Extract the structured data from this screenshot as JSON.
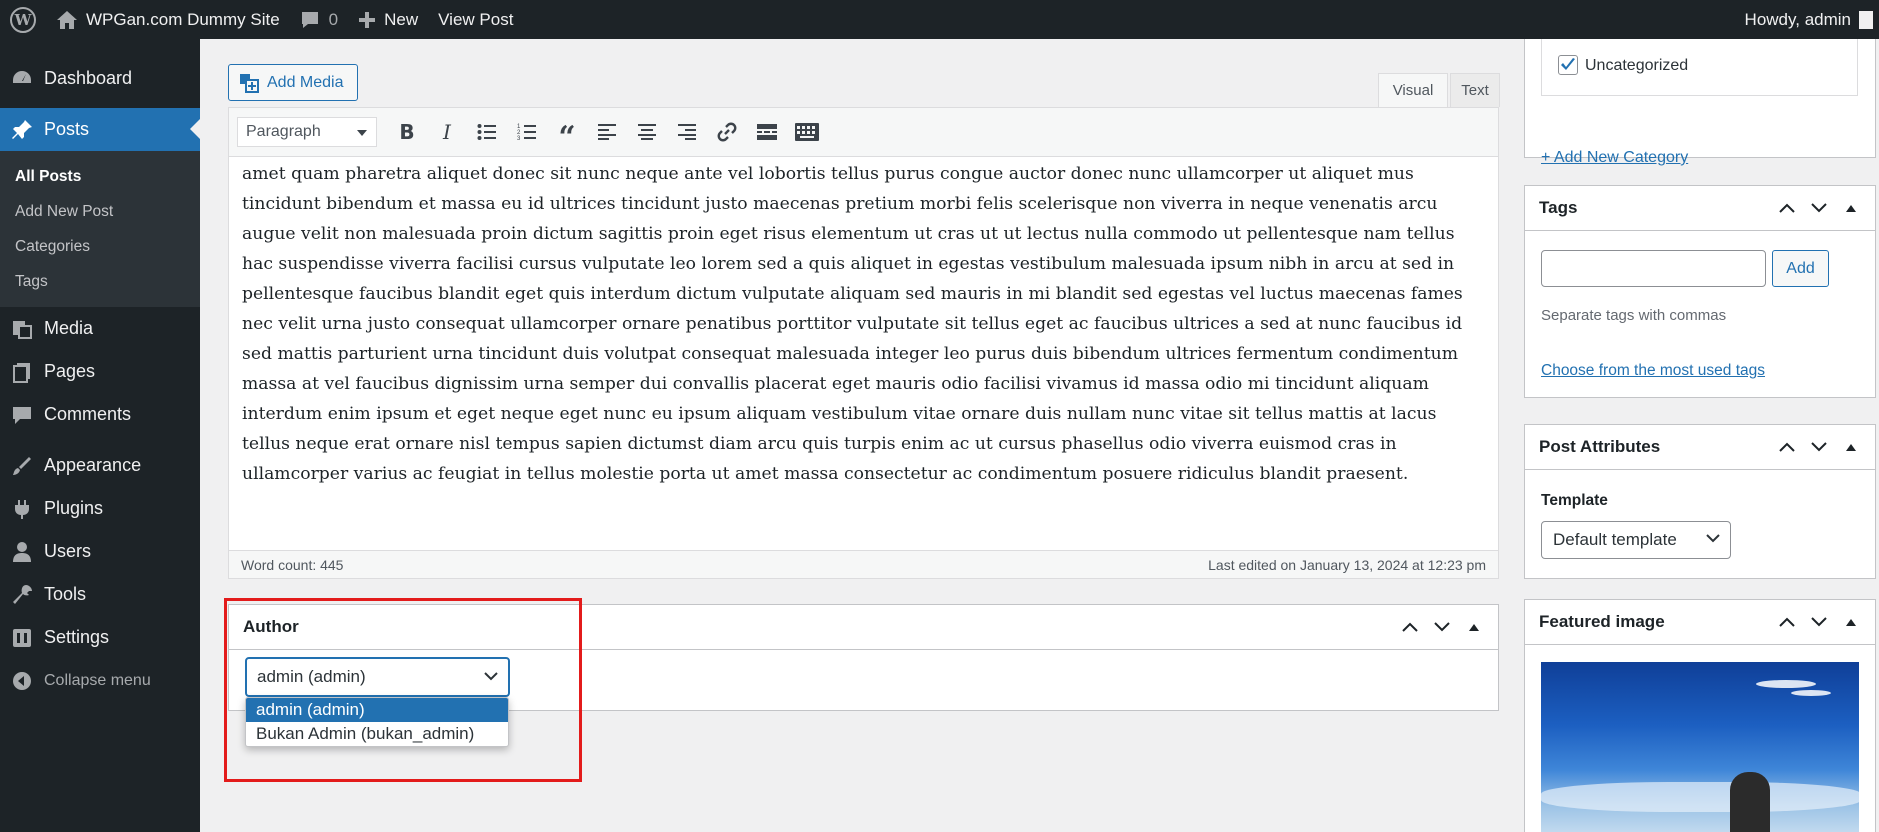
{
  "adminbar": {
    "site_name": "WPGan.com Dummy Site",
    "comments_count": "0",
    "new_label": "New",
    "view_post_label": "View Post",
    "howdy": "Howdy, admin"
  },
  "sidebar": {
    "items": [
      {
        "label": "Dashboard",
        "icon": "dashboard-icon"
      },
      {
        "label": "Posts",
        "icon": "pin-icon"
      },
      {
        "label": "Media",
        "icon": "media-icon"
      },
      {
        "label": "Pages",
        "icon": "pages-icon"
      },
      {
        "label": "Comments",
        "icon": "comments-icon"
      },
      {
        "label": "Appearance",
        "icon": "appearance-icon"
      },
      {
        "label": "Plugins",
        "icon": "plugins-icon"
      },
      {
        "label": "Users",
        "icon": "users-icon"
      },
      {
        "label": "Tools",
        "icon": "tools-icon"
      },
      {
        "label": "Settings",
        "icon": "settings-icon"
      }
    ],
    "posts_submenu": [
      "All Posts",
      "Add New Post",
      "Categories",
      "Tags"
    ],
    "collapse_label": "Collapse menu"
  },
  "editor": {
    "add_media_label": "Add Media",
    "tab_visual": "Visual",
    "tab_text": "Text",
    "format_select": "Paragraph",
    "body_text": "amet quam pharetra aliquet donec sit nunc neque ante vel lobortis tellus purus congue auctor donec nunc ullamcorper ut aliquet mus tincidunt bibendum et massa eu id ultrices tincidunt justo maecenas pretium morbi felis scelerisque non viverra in neque venenatis arcu augue velit non malesuada proin dictum sagittis proin eget risus elementum ut cras ut ut lectus nulla commodo ut pellentesque nam tellus hac suspendisse viverra facilisi cursus vulputate leo lorem sed a quis aliquet in egestas vestibulum malesuada ipsum nibh in arcu at sed in pellentesque faucibus blandit eget quis interdum dictum vulputate aliquam sed mauris in mi blandit sed egestas vel luctus maecenas fames nec velit urna justo consequat ullamcorper ornare penatibus porttitor vulputate sit tellus eget ac faucibus ultrices a sed at nunc faucibus id sed mattis parturient urna tincidunt duis volutpat consequat malesuada integer leo purus duis bibendum ultrices fermentum condimentum massa at vel faucibus dignissim urna semper dui convallis placerat eget mauris odio facilisi vivamus id massa odio mi tincidunt aliquam interdum enim ipsum et eget neque eget nunc eu ipsum aliquam vestibulum vitae ornare duis nullam nunc vitae sit tellus mattis at lacus tellus neque erat ornare nisl tempus sapien dictumst diam arcu quis turpis enim ac ut cursus phasellus odio viverra euismod cras in ullamcorper varius ac feugiat in tellus molestie porta ut amet massa consectetur ac condimentum posuere ridiculus blandit praesent.",
    "word_count": "Word count: 445",
    "last_edited": "Last edited on January 13, 2024 at 12:23 pm"
  },
  "author_box": {
    "title": "Author",
    "selected": "admin (admin)",
    "options": [
      "admin (admin)",
      "Bukan Admin (bukan_admin)"
    ]
  },
  "categories": {
    "item": "Uncategorized",
    "checked": true,
    "add_new": "+ Add New Category"
  },
  "tags": {
    "title": "Tags",
    "input_value": "",
    "add_label": "Add",
    "hint": "Separate tags with commas",
    "choose_link": "Choose from the most used tags"
  },
  "post_attributes": {
    "title": "Post Attributes",
    "template_label": "Template",
    "template_value": "Default template"
  },
  "featured_image": {
    "title": "Featured image"
  },
  "colors": {
    "admin_dark": "#1d2327",
    "accent_blue": "#2271b1",
    "highlight_red": "#e31b1b"
  }
}
